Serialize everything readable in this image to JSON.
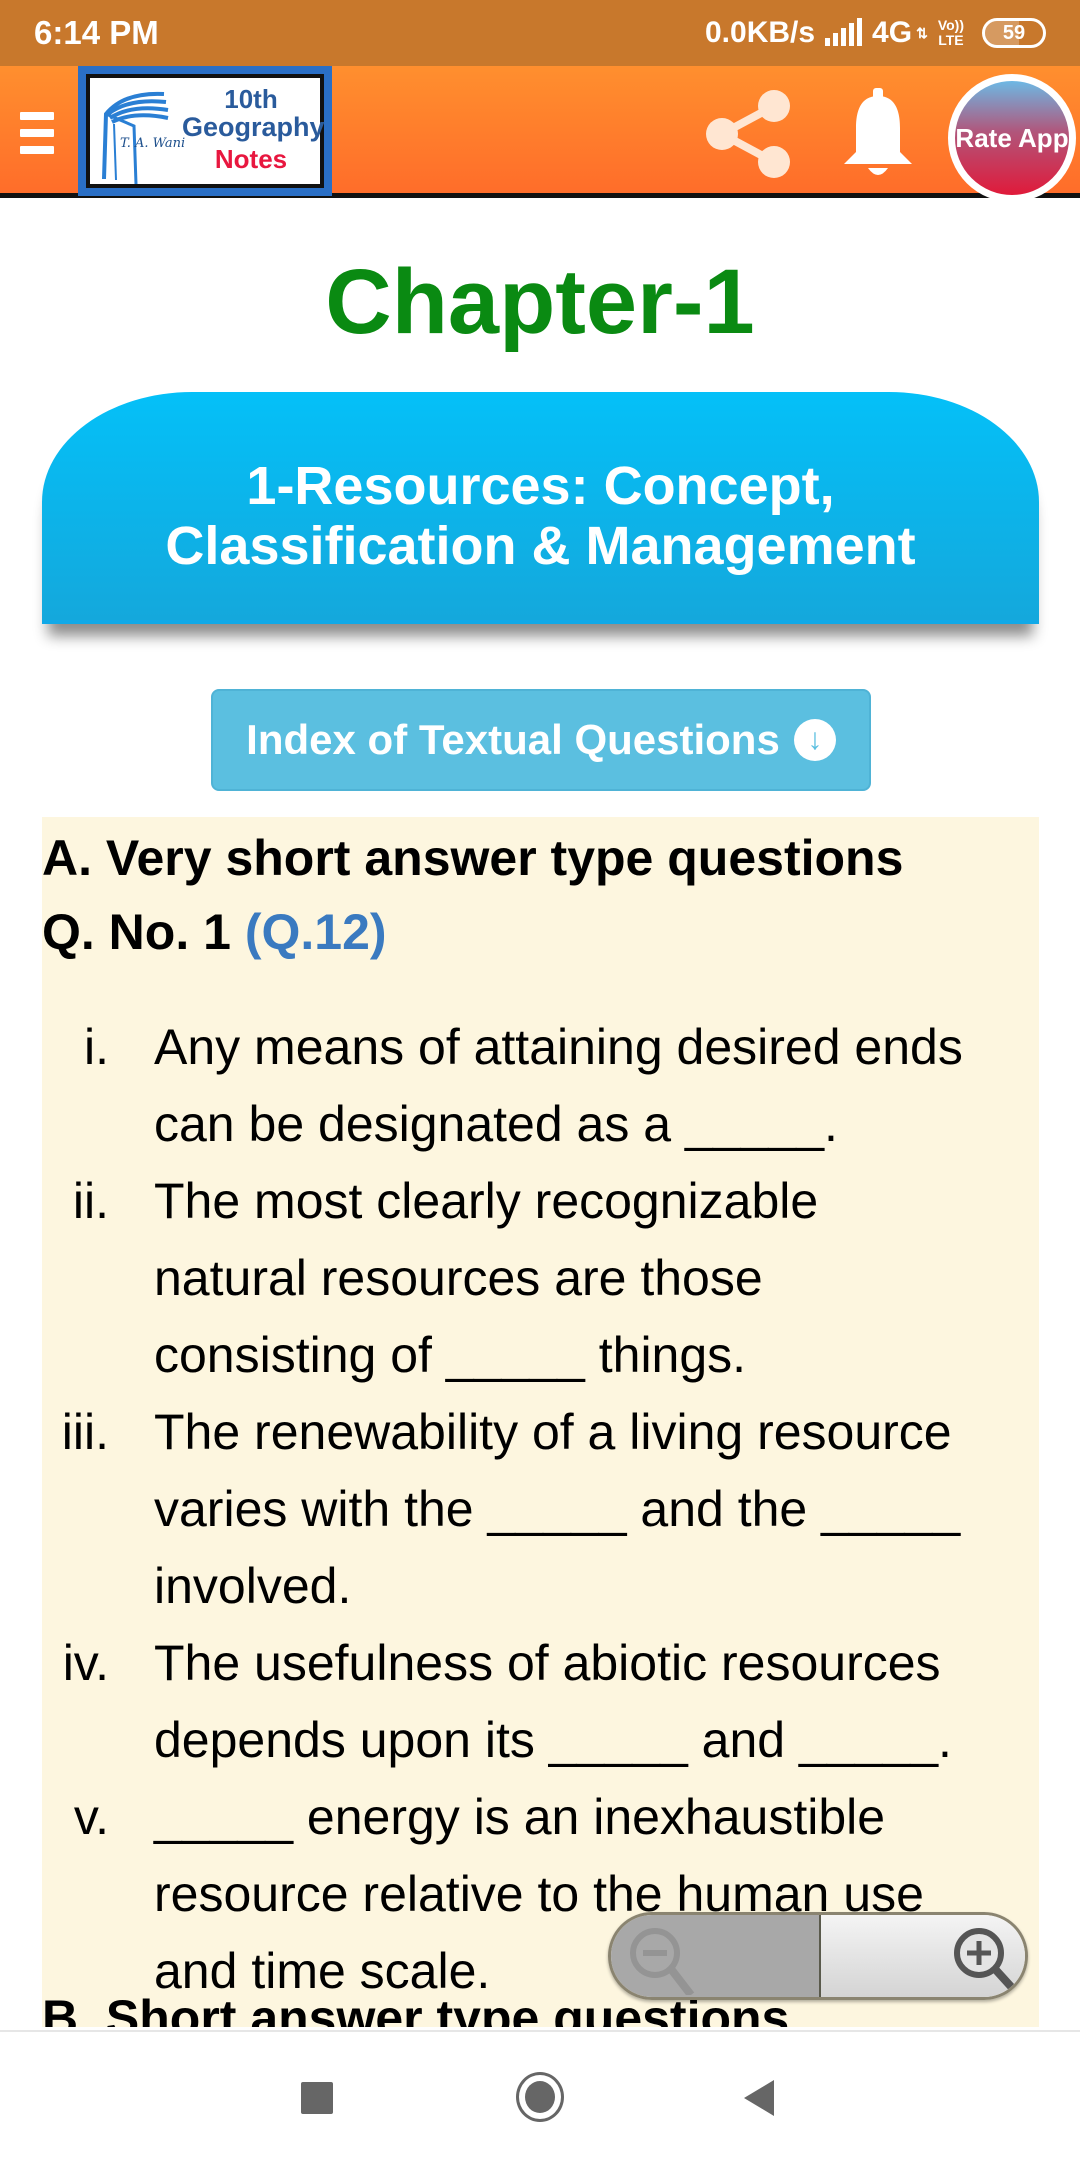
{
  "status_bar": {
    "time": "6:14 PM",
    "network_speed": "0.0KB/s",
    "network_type": "4G",
    "volte_top": "Vo))",
    "volte_bottom": "LTE",
    "battery_level": "59",
    "battery_fraction": 0.59
  },
  "app_bar": {
    "menu_icon": "hamburger-menu-icon",
    "logo": {
      "line1": "10th",
      "line2": "Geography",
      "line3": "Notes",
      "signature": "T. A. Wani"
    },
    "share_icon": "share-icon",
    "notification_icon": "bell-icon",
    "rate_button": "Rate App"
  },
  "content": {
    "chapter_title": "Chapter-1",
    "banner_title": "1-Resources: Concept, Classification & Management",
    "index_button": "Index of Textual Questions",
    "index_icon": "arrow-down-circle-icon",
    "section_heading": "A. Very short answer type questions",
    "question_number": "Q. No. 1",
    "question_ref": "(Q.12)",
    "questions": [
      {
        "num": "i.",
        "text": "Any means of attaining desired ends\ncan be designated as a _____."
      },
      {
        "num": "ii.",
        "text": "The most clearly recognizable\nnatural resources are those\nconsisting of _____ things."
      },
      {
        "num": "iii.",
        "text": "The renewability of a living resource\nvaries with the _____ and the _____\ninvolved."
      },
      {
        "num": "iv.",
        "text": "The usefulness of abiotic resources\ndepends upon its _____ and _____."
      },
      {
        "num": "v.",
        "text": "_____ energy is an inexhaustible\nresource relative to the human use\nand time scale."
      }
    ],
    "next_section_heading": "B. Short answer type questions"
  },
  "zoom_control": {
    "zoom_out_icon": "zoom-out-icon",
    "zoom_in_icon": "zoom-in-icon"
  },
  "nav_bar": {
    "recent": "recent-apps-icon",
    "home": "home-icon",
    "back": "back-icon"
  },
  "colors": {
    "status_bar": "#c8782c",
    "app_bar": "#ff7d2c",
    "chapter_title": "#0a8a12",
    "banner": "#04c0f8",
    "index_button": "#5bbfe0",
    "qa_background": "#fdf6df",
    "question_ref": "#3a7ac0",
    "logo_notes": "#e8173f"
  }
}
